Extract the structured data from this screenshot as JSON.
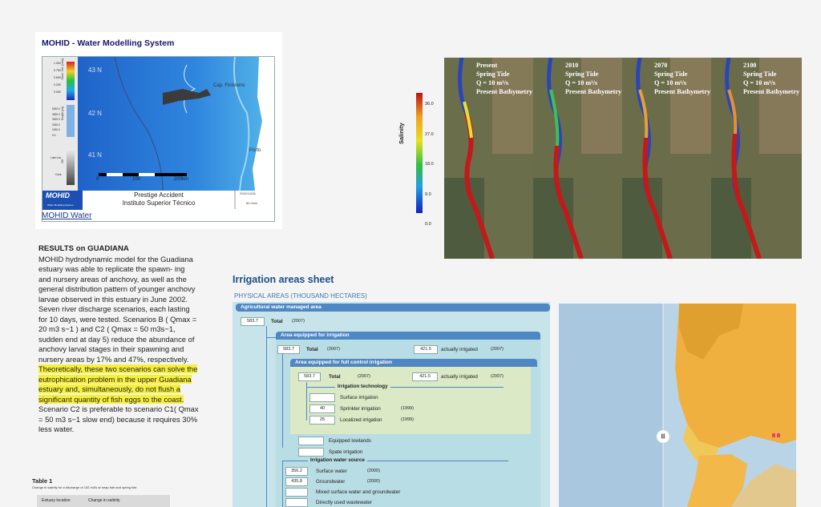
{
  "mohid": {
    "title": "MOHID - Water Modelling System",
    "link": "MOHID Water",
    "legend_top": [
      "1.000",
      "0.750",
      "0.500",
      "0.250",
      "0.000"
    ],
    "legend_depth": [
      "5000.0",
      "4000.0",
      "3000.0",
      "2000.0",
      "1000.0",
      "0.0"
    ],
    "side_labels": [
      "Mod. Vel. [m/s]",
      "Depth [m]",
      "Oil"
    ],
    "lat_labels": [
      "43 N",
      "42 N",
      "41 N"
    ],
    "oil_labels": [
      "Last Loc.",
      "Cont."
    ],
    "places": [
      "Cap. Finisterre",
      "Porto"
    ],
    "scale_labels": [
      "0",
      "100",
      "200km"
    ],
    "caption_line1": "Prestige Accident",
    "caption_line2": "Instituto Superior Técnico",
    "date": "2002/11/06",
    "time": "6h 0min",
    "logo": "MOHID",
    "logo_sub": "Water Modelling System"
  },
  "results": {
    "heading": "RESULTS on GUADIANA",
    "para1": "MOHID hydrodynamic model for the Guadiana estuary was able to replicate the spawn- ing and nursery areas of anchovy, as well as the general distribution pattern of younger anchovy larvae observed in this estuary in June 2002. Seven river discharge scenarios, each lasting for 10 days, were tested. Scenarios B ( Qmax = 20 m3 s−1 ) and C2 ( Qmax = 50 m3s−1, sudden end at day 5) reduce the abundance of anchovy larval stages in their spawning and nursery areas by 17% and 47%, respectively.",
    "highlight": "Theoretically, these two scenarios can solve the eutrophication problem in the upper Guadiana estuary and, simultaneously, do not flush a significant quantity of fish eggs to the coast.",
    "para2": " Scenario C2 is preferable to scenario C1( Qmax = 50 m3 s−1 slow end) because it requires 30% less water."
  },
  "table1": {
    "title": "Table 1",
    "caption": "Change in salinity for a discharge of 100 m3/s at neap tide and spring tide",
    "col1": "Estuary location",
    "col2": "Change in salinity"
  },
  "salinity": {
    "label": "Salinity",
    "ticks": [
      "36.0",
      "27.0",
      "18.0",
      "9.0",
      "0.0"
    ]
  },
  "scenarios": [
    {
      "year": "Present",
      "tide": "Spring Tide",
      "q": "Q = 10 m³/s",
      "bath": "Present Bathymetry"
    },
    {
      "year": "2010",
      "tide": "Spring Tide",
      "q": "Q = 10 m³/s",
      "bath": "Present Bathymetry"
    },
    {
      "year": "2070",
      "tide": "Spring Tide",
      "q": "Q = 10 m³/s",
      "bath": "Present Bathymetry"
    },
    {
      "year": "2100",
      "tide": "Spring Tide",
      "q": "Q = 10 m³/s",
      "bath": "Present Bathymetry"
    }
  ],
  "irrigation": {
    "title": "Irrigation areas sheet",
    "subtitle": "PHYSICAL AREAS (THOUSAND HECTARES)",
    "bar_managed": "Agricultural water managed area",
    "managed_value": "583.7",
    "total_label": "Total",
    "year_2007": "(2007)",
    "bar_equipped": "Area equipped for irrigation",
    "equipped_value": "583.7",
    "actually_value": "421.5",
    "actually_label": "actually irrigated",
    "bar_full_control": "Area equipped for full control irrigation",
    "full_value": "583.7",
    "full_actually_value": "421.5",
    "tech_heading": "Irrigation technology",
    "surface_irr": "Surface irrigation",
    "sprinkler_value": "40",
    "sprinkler": "Sprinkler irrigation",
    "sprinkler_year": "(1999)",
    "localized_value": "25",
    "localized": "Localized irrigation",
    "localized_year": "(1999)",
    "equipped_lowlands": "Equipped lowlands",
    "spate": "Spate irrigation",
    "source_heading": "Irrigation water source",
    "surface_water_value": "356.2",
    "surface_water": "Surface water",
    "surface_water_year": "(2000)",
    "groundwater_value": "435.8",
    "groundwater": "Groundwater",
    "groundwater_year": "(2000)",
    "mixed": "Mixed surface water and groundwater",
    "wastewater": "Directly used wastewater"
  },
  "map": {
    "handle": "|||"
  }
}
